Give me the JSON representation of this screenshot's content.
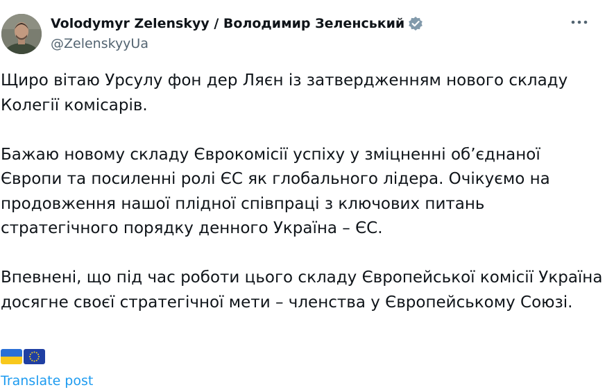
{
  "author": {
    "display_name": "Volodymyr Zelenskyy / Володимир Зеленський",
    "handle": "@ZelenskyyUa",
    "verified": true,
    "verified_color": "#829aab"
  },
  "icons": {
    "more": "more-horizontal-icon",
    "verified": "verified-badge-icon"
  },
  "tweet": {
    "paragraphs": [
      "Щиро вітаю Урсулу фон дер Ляєн із затвердженням нового складу Колегії комісарів.",
      "Бажаю новому складу Єврокомісії успіху у зміцненні об’єднаної Європи та посиленні ролі ЄС як глобального лідера. Очікуємо на продовження нашої плідної співпраці з ключових питань стратегічного порядку денного Україна – ЄС.",
      "Впевнені, що під час роботи цього складу Європейської комісії Україна досягне своєї стратегічної мети – членства у Європейському Союзі."
    ],
    "flags": [
      "flag-ukraine",
      "flag-european-union"
    ]
  },
  "actions": {
    "translate_label": "Translate post",
    "link_color": "#1d9bf0"
  }
}
